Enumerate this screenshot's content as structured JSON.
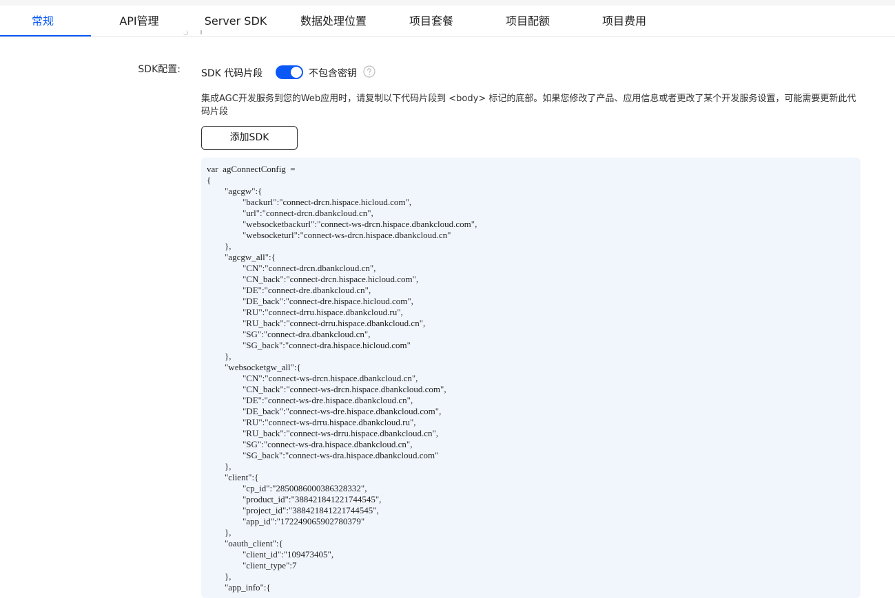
{
  "tabs": [
    {
      "label": "常规",
      "active": true
    },
    {
      "label": "API管理",
      "active": false
    },
    {
      "label": "Server SDK",
      "active": false
    },
    {
      "label": "数据处理位置",
      "active": false
    },
    {
      "label": "项目套餐",
      "active": false
    },
    {
      "label": "项目配额",
      "active": false
    },
    {
      "label": "项目费用",
      "active": false
    }
  ],
  "sdk_config": {
    "label": "SDK配置:",
    "snippet_label": "SDK 代码片段",
    "toggle_on": true,
    "toggle_label": "不包含密钥",
    "help_icon": "question-circle-icon",
    "description": "集成AGC开发服务到您的Web应用时，请复制以下代码片段到 <body> 标记的底部。如果您修改了产品、应用信息或者更改了某个开发服务设置，可能需要更新此代码片段",
    "add_button_label": "添加SDK",
    "code": "var  agConnectConfig  =\n{\n\t\"agcgw\":{\n\t\t\"backurl\":\"connect-drcn.hispace.hicloud.com\",\n\t\t\"url\":\"connect-drcn.dbankcloud.cn\",\n\t\t\"websocketbackurl\":\"connect-ws-drcn.hispace.dbankcloud.com\",\n\t\t\"websocketurl\":\"connect-ws-drcn.hispace.dbankcloud.cn\"\n\t},\n\t\"agcgw_all\":{\n\t\t\"CN\":\"connect-drcn.dbankcloud.cn\",\n\t\t\"CN_back\":\"connect-drcn.hispace.hicloud.com\",\n\t\t\"DE\":\"connect-dre.dbankcloud.cn\",\n\t\t\"DE_back\":\"connect-dre.hispace.hicloud.com\",\n\t\t\"RU\":\"connect-drru.hispace.dbankcloud.ru\",\n\t\t\"RU_back\":\"connect-drru.hispace.dbankcloud.cn\",\n\t\t\"SG\":\"connect-dra.dbankcloud.cn\",\n\t\t\"SG_back\":\"connect-dra.hispace.hicloud.com\"\n\t},\n\t\"websocketgw_all\":{\n\t\t\"CN\":\"connect-ws-drcn.hispace.dbankcloud.cn\",\n\t\t\"CN_back\":\"connect-ws-drcn.hispace.dbankcloud.com\",\n\t\t\"DE\":\"connect-ws-dre.hispace.dbankcloud.cn\",\n\t\t\"DE_back\":\"connect-ws-dre.hispace.dbankcloud.com\",\n\t\t\"RU\":\"connect-ws-drru.hispace.dbankcloud.ru\",\n\t\t\"RU_back\":\"connect-ws-drru.hispace.dbankcloud.cn\",\n\t\t\"SG\":\"connect-ws-dra.hispace.dbankcloud.cn\",\n\t\t\"SG_back\":\"connect-ws-dra.hispace.dbankcloud.com\"\n\t},\n\t\"client\":{\n\t\t\"cp_id\":\"2850086000386328332\",\n\t\t\"product_id\":\"388421841221744545\",\n\t\t\"project_id\":\"388421841221744545\",\n\t\t\"app_id\":\"172249065902780379\"\n\t},\n\t\"oauth_client\":{\n\t\t\"client_id\":\"109473405\",\n\t\t\"client_type\":7\n\t},\n\t\"app_info\":{"
  },
  "colors": {
    "accent": "#0a59f7",
    "code_bg": "#f1f6fd"
  }
}
